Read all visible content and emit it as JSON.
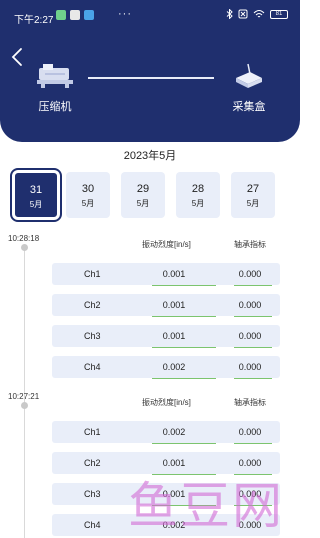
{
  "status_bar": {
    "time": "下午2:27",
    "dots": "···",
    "battery": "81"
  },
  "devices": {
    "left_label": "压缩机",
    "right_label": "采集盒"
  },
  "month_title": "2023年5月",
  "dates": [
    {
      "day": "31",
      "month": "5月",
      "active": true
    },
    {
      "day": "30",
      "month": "5月",
      "active": false
    },
    {
      "day": "29",
      "month": "5月",
      "active": false
    },
    {
      "day": "28",
      "month": "5月",
      "active": false
    },
    {
      "day": "27",
      "month": "5月",
      "active": false
    }
  ],
  "columns": {
    "vibration": "振动烈度[in/s]",
    "bearing": "轴承指标"
  },
  "records": [
    {
      "time": "10:28:18",
      "rows": [
        {
          "channel": "Ch1",
          "vibration": "0.001",
          "bearing": "0.000"
        },
        {
          "channel": "Ch2",
          "vibration": "0.001",
          "bearing": "0.000"
        },
        {
          "channel": "Ch3",
          "vibration": "0.001",
          "bearing": "0.000"
        },
        {
          "channel": "Ch4",
          "vibration": "0.002",
          "bearing": "0.000"
        }
      ]
    },
    {
      "time": "10:27:21",
      "rows": [
        {
          "channel": "Ch1",
          "vibration": "0.002",
          "bearing": "0.000"
        },
        {
          "channel": "Ch2",
          "vibration": "0.001",
          "bearing": "0.000"
        },
        {
          "channel": "Ch3",
          "vibration": "0.001",
          "bearing": "0.000"
        },
        {
          "channel": "Ch4",
          "vibration": "0.002",
          "bearing": "0.000"
        }
      ]
    }
  ],
  "watermark": "鱼豆网",
  "colors": {
    "header": "#1f2f6e",
    "card": "#e9eef9",
    "underline": "#7cc46e"
  }
}
